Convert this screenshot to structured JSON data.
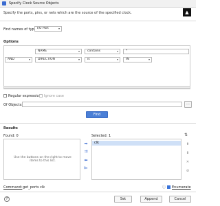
{
  "window": {
    "title": "Specify Clock Source Objects"
  },
  "description": "Specify the ports, pins, or nets which are the source of the specified clock.",
  "find_names": {
    "label": "Find names of type:",
    "value": "I/O Port"
  },
  "options": {
    "label": "Options",
    "row1": {
      "field": "NAME",
      "operator": "contains",
      "value": "*"
    },
    "row2": {
      "logic": "AND",
      "field": "DIRECTION",
      "operator": "is",
      "value": "IN"
    }
  },
  "regex": {
    "label": "Regular expression",
    "checked": false
  },
  "ignore_case": {
    "label": "Ignore case",
    "checked": false
  },
  "of_objects": {
    "label": "Of Objects:",
    "value": "",
    "more_label": "..."
  },
  "find_button": "Find",
  "results": {
    "label": "Results",
    "found_label": "Found: 0",
    "selected_label": "Selected: 1",
    "empty_hint": "Use the buttons on the right to move items to this list.",
    "selected_items": [
      "clk"
    ]
  },
  "command": {
    "label": "Command:",
    "value": "get_ports clk",
    "enumerate_label": "Enumerate",
    "enumerate_checked": true
  },
  "buttons": {
    "help": "?",
    "set": "Set",
    "append": "Append",
    "cancel": "Cancel"
  },
  "icons": [
    "app-icon",
    "logo-icon",
    "chevron-down-icon",
    "sort-az-icon",
    "move-right-icon",
    "move-all-right-icon",
    "move-left-icon",
    "move-all-left-icon",
    "move-up-icon",
    "move-down-icon",
    "remove-icon",
    "clear-icon",
    "help-icon"
  ]
}
